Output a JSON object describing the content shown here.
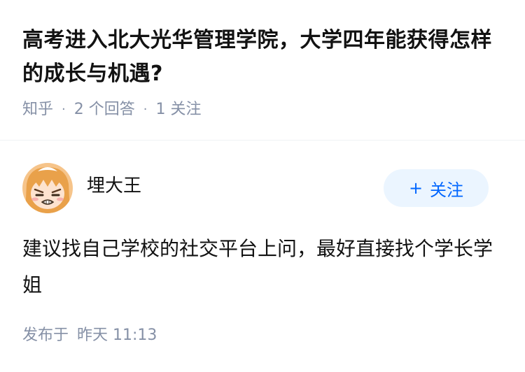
{
  "question": {
    "title": "高考进入北大光华管理学院，大学四年能获得怎样的成长与机遇?",
    "source": "知乎",
    "answers_count": "2 个回答",
    "followers_count": "1 关注"
  },
  "answer": {
    "author_name": "埋大王",
    "avatar_icon": "anime-girl-avatar-icon",
    "follow_plus": "+",
    "follow_label": "关注",
    "content": "建议找自己学校的社交平台上问，最好直接找个学长学姐",
    "time_prefix": "发布于",
    "time_value": "昨天 11:13"
  },
  "colors": {
    "accent": "#0066ff",
    "follow_bg": "#ebf5ff",
    "meta_gray": "#8590a6",
    "text": "#121212"
  }
}
